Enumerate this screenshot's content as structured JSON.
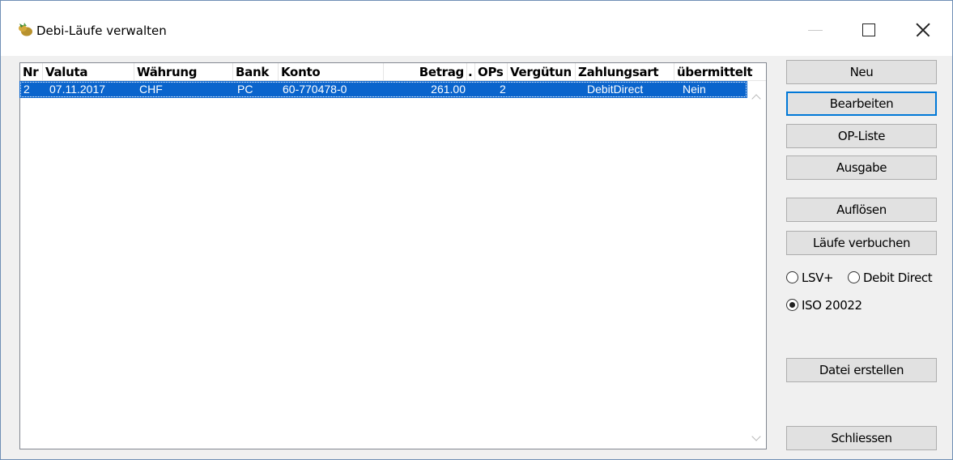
{
  "window": {
    "title": "Debi-Läufe verwalten",
    "icon": "money-bag-icon"
  },
  "list": {
    "columns": [
      "Nr",
      "Valuta",
      "Währung",
      "Bank",
      "Konto",
      "Betrag",
      ".",
      "OPs",
      "Vergütun",
      "Zahlungsart",
      "übermittelt"
    ],
    "rows": [
      {
        "nr": "2",
        "valuta": "07.11.2017",
        "waehrung": "CHF",
        "bank": "PC",
        "konto": "60-770478-0",
        "betrag": "261.00",
        "ops": "2",
        "verguetung": "",
        "zahlungsart": "DebitDirect",
        "uebermittelt": "Nein"
      }
    ]
  },
  "buttons": {
    "neu": "Neu",
    "bearbeiten": "Bearbeiten",
    "op_liste": "OP-Liste",
    "ausgabe": "Ausgabe",
    "aufloesen": "Auflösen",
    "laeufe_verbuchen": "Läufe verbuchen",
    "datei_erstellen": "Datei erstellen",
    "schliessen": "Schliessen"
  },
  "format_options": {
    "lsv": "LSV+",
    "debit_direct": "Debit Direct",
    "iso": "ISO 20022",
    "selected": "ISO 20022"
  },
  "colors": {
    "selection": "#0a64cc",
    "focus_border": "#0078d7"
  }
}
